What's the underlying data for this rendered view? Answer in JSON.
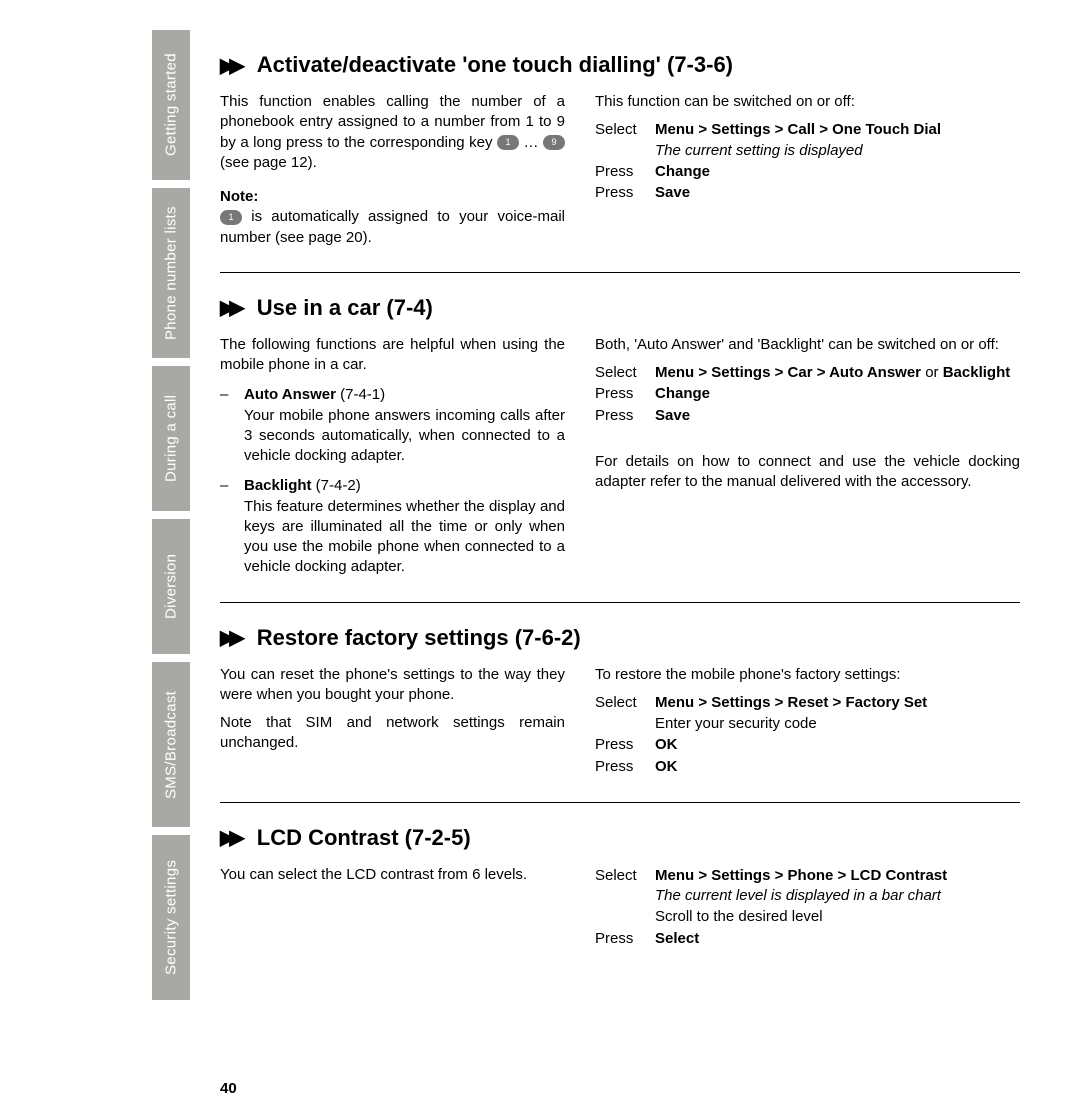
{
  "sidebar": {
    "tabs": [
      "Getting started",
      "Phone number lists",
      "During a call",
      "Diversion",
      "SMS/Broadcast",
      "Security settings"
    ]
  },
  "page_number": "40",
  "sections": [
    {
      "title": "Activate/deactivate 'one touch dialling' (7-3-6)",
      "left": {
        "p1_a": "This function enables calling the number of a phonebook entry assigned to a number from 1 to 9 by a long press to the corresponding key ",
        "key1": "1",
        "ellipsis": " … ",
        "key9": "9",
        "p1_b": " (see page 12).",
        "note_label": "Note:",
        "note_key": "1",
        "note_text": " is automatically assigned to your voice-mail number (see page 20)."
      },
      "right": {
        "intro": "This function can be switched on or off:",
        "steps": [
          {
            "label": "Select",
            "bold": "Menu > Settings > Call > One Touch Dial",
            "italic": "The current setting is displayed"
          },
          {
            "label": "Press",
            "bold": "Change"
          },
          {
            "label": "Press",
            "bold": "Save"
          }
        ]
      }
    },
    {
      "title": "Use in a car (7-4)",
      "left": {
        "intro": "The following functions are helpful when using the mobile phone in a car.",
        "items": [
          {
            "title": "Auto Answer",
            "code": " (7-4-1)",
            "body": "Your mobile phone answers incoming calls after 3 seconds automatically, when connected to a vehicle docking adapter."
          },
          {
            "title": "Backlight",
            "code": " (7-4-2)",
            "body": "This feature determines whether the display and keys are illuminated all the time or only when you use the mobile phone when connected to a vehicle docking adapter."
          }
        ]
      },
      "right": {
        "intro": "Both, 'Auto Answer' and 'Backlight' can be switched on or off:",
        "steps": [
          {
            "label": "Select",
            "bold": "Menu > Settings > Car > Auto Answer",
            "plain_mid": " or ",
            "bold2": "Backlight"
          },
          {
            "label": "Press",
            "bold": "Change"
          },
          {
            "label": "Press",
            "bold": "Save"
          }
        ],
        "trailer": "For details on how to connect and use the vehicle docking adapter refer to the manual delivered with the accessory."
      }
    },
    {
      "title": "Restore factory settings (7-6-2)",
      "left": {
        "p1": "You can reset the phone's settings to the way they were when you bought your phone.",
        "p2": "Note that SIM and network settings remain unchanged."
      },
      "right": {
        "intro": "To restore the mobile phone's factory settings:",
        "steps": [
          {
            "label": "Select",
            "bold": "Menu > Settings > Reset > Factory Set"
          },
          {
            "label": "",
            "plain": "Enter your security code"
          },
          {
            "label": "Press",
            "bold": "OK"
          },
          {
            "label": "Press",
            "bold": "OK"
          }
        ]
      }
    },
    {
      "title": "LCD Contrast (7-2-5)",
      "left": {
        "p1": "You can select the LCD contrast from 6 levels."
      },
      "right": {
        "steps": [
          {
            "label": "Select",
            "bold": "Menu > Settings > Phone > LCD Contrast",
            "italic": "The current level is displayed in a bar chart"
          },
          {
            "label": "",
            "plain": "Scroll to the desired level"
          },
          {
            "label": "Press",
            "bold": "Select"
          }
        ]
      }
    }
  ]
}
